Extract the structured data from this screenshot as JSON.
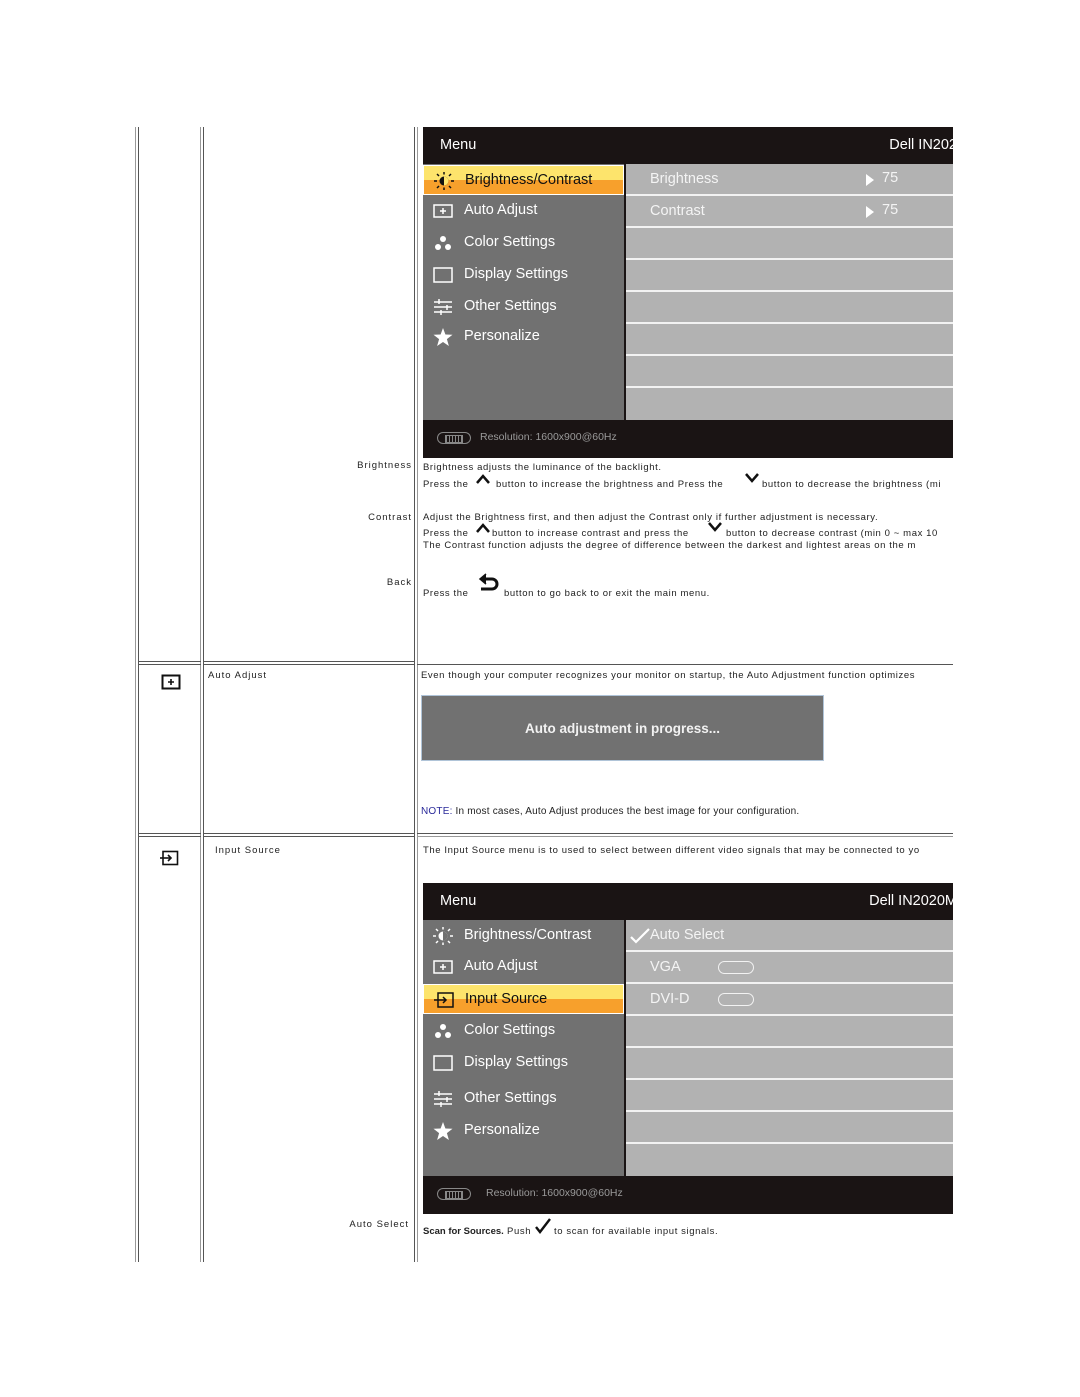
{
  "table": {
    "rows": [
      {
        "id": "brightness-contrast",
        "osd": {
          "title": "Menu",
          "model": "Dell IN202",
          "items": [
            {
              "label": "Brightness/Contrast",
              "icon": "sun-icon",
              "active": true
            },
            {
              "label": "Auto Adjust",
              "icon": "auto-adjust-icon"
            },
            {
              "label": "Color Settings",
              "icon": "color-dots-icon"
            },
            {
              "label": "Display Settings",
              "icon": "display-icon"
            },
            {
              "label": "Other Settings",
              "icon": "sliders-icon"
            },
            {
              "label": "Personalize",
              "icon": "star-icon"
            }
          ],
          "settings": [
            {
              "label": "Brightness",
              "value": "75"
            },
            {
              "label": "Contrast",
              "value": "75"
            }
          ],
          "footer": "Resolution:  1600x900@60Hz"
        },
        "sub": [
          {
            "label": "Brightness",
            "lines": [
              "Brightness adjusts the luminance of the backlight.",
              {
                "pre": "Press the",
                "mid": "button to increase the brightness and Press the",
                "post": "button to decrease the brightness (mi"
              }
            ]
          },
          {
            "label": "Contrast",
            "lines": [
              "Adjust the Brightness first, and then adjust the Contrast only if further adjustment is necessary.",
              {
                "pre": "Press the",
                "mid": "button to increase contrast and press the",
                "post": "button to decrease contrast (min 0 ~  max 10"
              },
              "The Contrast function adjusts the degree of difference between the darkest and lightest areas on the m"
            ]
          },
          {
            "label": "Back",
            "lines": [
              {
                "pre": "Press the",
                "post": "button to go back to or exit the main menu."
              }
            ]
          }
        ]
      },
      {
        "id": "auto-adjust",
        "icon": "auto-adjust-icon",
        "label": "Auto Adjust",
        "description": "Even though your computer recognizes your monitor on startup, the Auto Adjustment function optimizes",
        "progress_box": "Auto adjustment in progress...",
        "note_key": "NOTE:",
        "note_text": " In most cases, Auto Adjust produces the best image for your configuration."
      },
      {
        "id": "input-source",
        "icon": "input-source-icon",
        "label": "Input Source",
        "description": "The Input Source menu is to used to select between different video signals that may be connected to yo",
        "osd": {
          "title": "Menu",
          "model": "Dell IN2020M",
          "items": [
            {
              "label": "Brightness/Contrast",
              "icon": "sun-icon"
            },
            {
              "label": "Auto Adjust",
              "icon": "auto-adjust-icon"
            },
            {
              "label": "Input Source",
              "icon": "input-source-icon",
              "active": true
            },
            {
              "label": "Color Settings",
              "icon": "color-dots-icon"
            },
            {
              "label": "Display Settings",
              "icon": "display-icon"
            },
            {
              "label": "Other Settings",
              "icon": "sliders-icon"
            },
            {
              "label": "Personalize",
              "icon": "star-icon"
            }
          ],
          "sources": [
            {
              "label": "Auto Select",
              "checked": true
            },
            {
              "label": "VGA",
              "connector": "vga-connector-icon"
            },
            {
              "label": "DVI-D",
              "connector": "dvi-connector-icon"
            }
          ],
          "footer": "Resolution:  1600x900@60Hz"
        },
        "sub": [
          {
            "label": "Auto Select",
            "bold": "Scan for Sources.",
            "pre": " Push",
            "post": "to scan for available input signals."
          }
        ]
      }
    ]
  }
}
